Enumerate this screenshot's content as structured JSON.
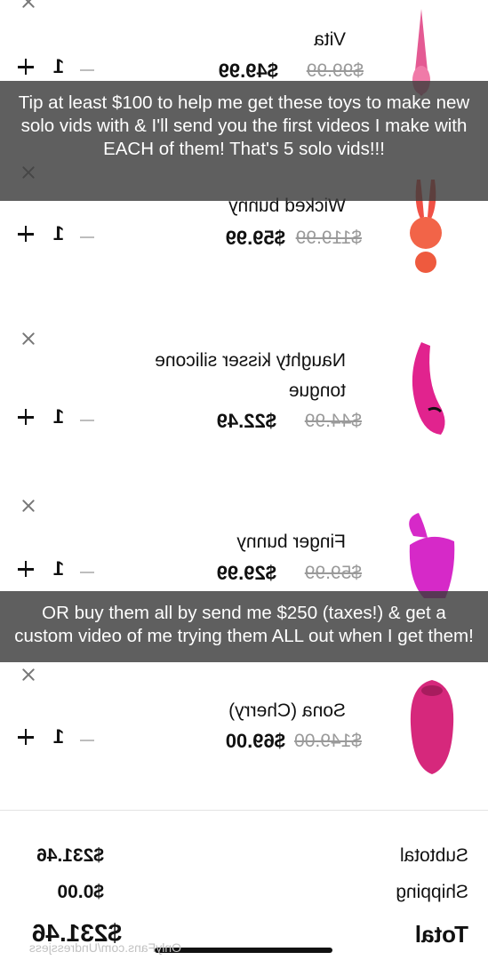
{
  "cart": {
    "items": [
      {
        "name": "Vita",
        "old_price": "$99.99",
        "new_price": "$49.99",
        "qty": "1",
        "color": "#e45a93"
      },
      {
        "name": "Wicked bunny",
        "old_price": "$119.99",
        "new_price": "$59.99",
        "qty": "1",
        "color": "#f05045"
      },
      {
        "name_line1": "Naughty kisser silicone",
        "name_line2": "tongue",
        "old_price": "$44.99",
        "new_price": "$22.49",
        "qty": "1",
        "color": "#e1238e"
      },
      {
        "name": "Finger bunny",
        "old_price": "$59.99",
        "new_price": "$29.99",
        "qty": "1",
        "color": "#d629c8"
      },
      {
        "name": "Sona (Cherry)",
        "old_price": "$149.00",
        "new_price": "$69.00",
        "qty": "1",
        "color": "#d6287c"
      }
    ]
  },
  "summary": {
    "subtotal_label": "Subtotal",
    "subtotal_value": "$231.46",
    "shipping_label": "Shipping",
    "shipping_value": "$0.00",
    "total_label": "Total",
    "total_value": "$231.46"
  },
  "captions": {
    "top": "Tip at least $100 to help me get these toys to make new solo vids with & I'll send you the first videos I make with EACH of them! That's 5 solo vids!!!",
    "bottom": "OR buy them all by send me $250 (taxes!) & get a custom video of me trying them ALL out when I get them!"
  },
  "watermark": "OnlyFans.com/Undressjess"
}
